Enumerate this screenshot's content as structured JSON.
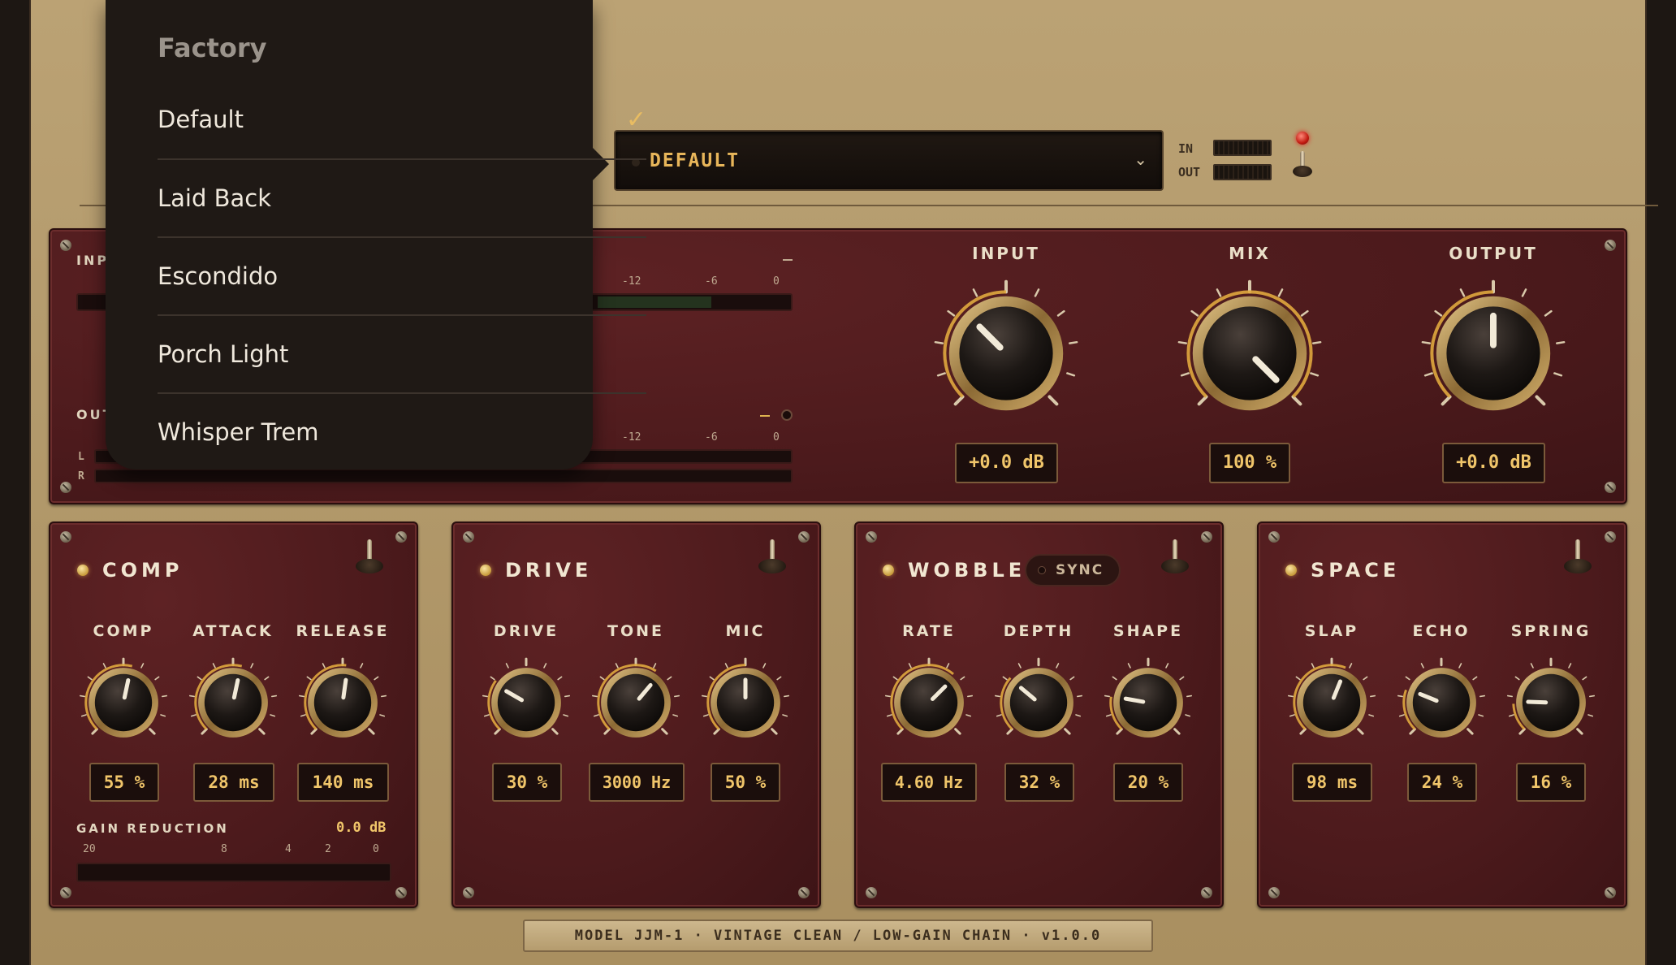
{
  "preset": {
    "name": "DEFAULT"
  },
  "io": {
    "in_label": "IN",
    "out_label": "OUT"
  },
  "dropdown": {
    "header": "Factory",
    "items": [
      {
        "label": "Default",
        "selected": true
      },
      {
        "label": "Laid Back",
        "selected": false
      },
      {
        "label": "Escondido",
        "selected": false
      },
      {
        "label": "Porch Light",
        "selected": false
      },
      {
        "label": "Whisper Trem",
        "selected": false
      }
    ],
    "check": "✓"
  },
  "meters": {
    "input_label": "INP",
    "output_label": "OUT",
    "scale": [
      "-12",
      "-6",
      "0"
    ],
    "left": "L",
    "right": "R"
  },
  "master": {
    "input": {
      "title": "INPUT",
      "value": "+0.0 dB"
    },
    "mix": {
      "title": "MIX",
      "value": "100 %"
    },
    "output": {
      "title": "OUTPUT",
      "value": "+0.0 dB"
    }
  },
  "comp": {
    "title": "COMP",
    "knobs": [
      {
        "title": "COMP",
        "value": "55 %"
      },
      {
        "title": "ATTACK",
        "value": "28 ms"
      },
      {
        "title": "RELEASE",
        "value": "140 ms"
      }
    ],
    "gr_label": "GAIN REDUCTION",
    "gr_value": "0.0 dB",
    "gr_scale": [
      "20",
      "8",
      "4",
      "2",
      "0"
    ]
  },
  "drive": {
    "title": "DRIVE",
    "knobs": [
      {
        "title": "DRIVE",
        "value": "30 %"
      },
      {
        "title": "TONE",
        "value": "3000 Hz"
      },
      {
        "title": "MIC",
        "value": "50 %"
      }
    ]
  },
  "wobble": {
    "title": "WOBBLE",
    "sync": "SYNC",
    "knobs": [
      {
        "title": "RATE",
        "value": "4.60 Hz"
      },
      {
        "title": "DEPTH",
        "value": "32 %"
      },
      {
        "title": "SHAPE",
        "value": "20 %"
      }
    ]
  },
  "space": {
    "title": "SPACE",
    "knobs": [
      {
        "title": "SLAP",
        "value": "98 ms"
      },
      {
        "title": "ECHO",
        "value": "24 %"
      },
      {
        "title": "SPRING",
        "value": "16 %"
      }
    ]
  },
  "footer": {
    "text": "MODEL JJM-1  ·  VINTAGE CLEAN / LOW-GAIN CHAIN  ·  v1.0.0"
  },
  "colors": {
    "accent": "#f0c56a",
    "panel": "#4c1a1c",
    "chassis": "#b39a6c"
  }
}
